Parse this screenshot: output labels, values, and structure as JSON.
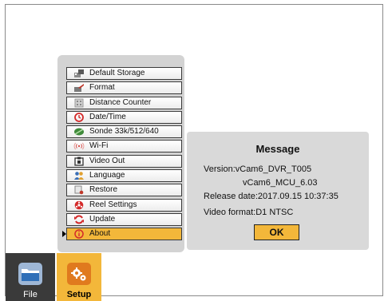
{
  "menu": {
    "items": [
      {
        "label": "Default Storage",
        "icon": "storage-icon",
        "selected": false
      },
      {
        "label": "Format",
        "icon": "format-icon",
        "selected": false
      },
      {
        "label": "Distance Counter",
        "icon": "counter-icon",
        "selected": false
      },
      {
        "label": "Date/Time",
        "icon": "clock-icon",
        "selected": false
      },
      {
        "label": "Sonde 33k/512/640",
        "icon": "sonde-icon",
        "selected": false
      },
      {
        "label": "Wi-Fi",
        "icon": "wifi-icon",
        "selected": false
      },
      {
        "label": "Video Out",
        "icon": "video-out-icon",
        "selected": false
      },
      {
        "label": "Language",
        "icon": "language-icon",
        "selected": false
      },
      {
        "label": "Restore",
        "icon": "restore-icon",
        "selected": false
      },
      {
        "label": "Reel Settings",
        "icon": "reel-icon",
        "selected": false
      },
      {
        "label": "Update",
        "icon": "update-icon",
        "selected": false
      },
      {
        "label": "About",
        "icon": "info-icon",
        "selected": true
      }
    ]
  },
  "message": {
    "title": "Message",
    "version": "Version:vCam6_DVR_T005",
    "mcu": "vCam6_MCU_6.03",
    "release": "Release date:2017.09.15 10:37:35",
    "format": "Video format:D1 NTSC",
    "ok_label": "OK"
  },
  "dock": {
    "file_label": "File",
    "setup_label": "Setup"
  },
  "colors": {
    "accent": "#f3b73a",
    "panel": "#d3d3d3",
    "dialog": "#d9d9d9",
    "dock_dark": "#3a3a3a"
  }
}
